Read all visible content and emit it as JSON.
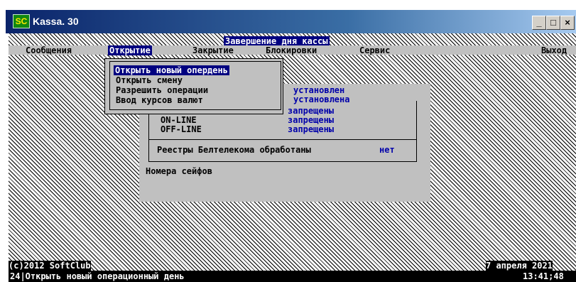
{
  "window": {
    "title": "Kassa. 30",
    "icon_label": "SC",
    "buttons": {
      "minimize": "_",
      "restore": "□",
      "close": "×"
    }
  },
  "dialog": {
    "title": "Завершение дня кассы"
  },
  "menubar": {
    "items": [
      "Сообщения",
      "Открытие",
      "Закрытие",
      "Блокировки",
      "Сервис",
      "Выход"
    ],
    "active": "Открытие"
  },
  "dropdown": {
    "items": [
      "Открыть новый опердень",
      "Открыть смену",
      "Разрешить операции",
      "Ввод курсов валют"
    ]
  },
  "panel": {
    "status_values": [
      "установлен",
      "установлена"
    ],
    "modes": [
      {
        "label": "",
        "value": "запрещены"
      },
      {
        "label": "ON-LINE",
        "value": "запрещены"
      },
      {
        "label": "OFF-LINE",
        "value": "запрещены"
      }
    ],
    "registry_label": "Реестры Белтелекома обработаны",
    "registry_value": "нет",
    "safes_label": "Номера сейфов"
  },
  "footer": {
    "copyright": "(c)2012 SoftClub",
    "date": "7 апреля 2021",
    "hint": "24|Открыть новый операционный день",
    "time": "13:41;48"
  },
  "colors": {
    "highlight": "#000080",
    "value_text": "#0000aa",
    "panel": "#c0c0c0"
  }
}
